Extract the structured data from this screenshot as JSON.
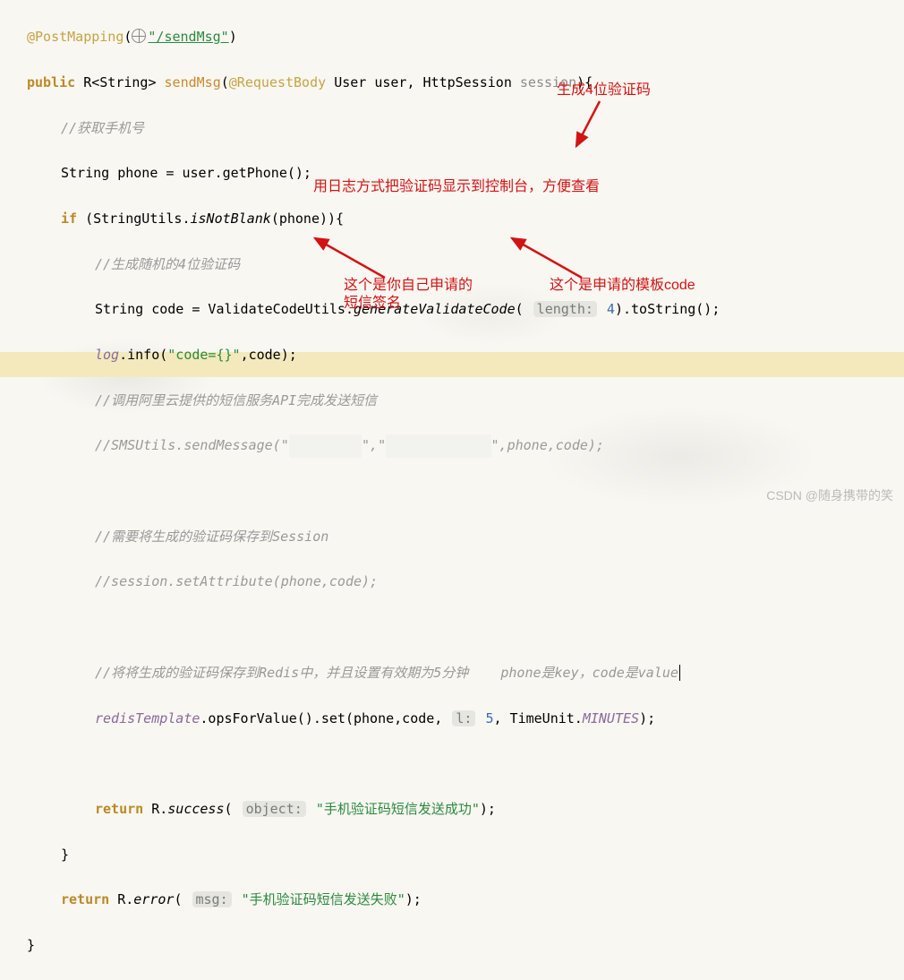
{
  "code": {
    "ann_name": "@PostMapping",
    "ann_path": "\"/sendMsg\"",
    "sig_public": "public",
    "sig_type": "R<String>",
    "sig_name": "sendMsg",
    "sig_params_ann": "@RequestBody",
    "sig_params_rest": "User user, HttpSession ",
    "sig_param_session": "session",
    "sig_tail": "){",
    "c1": "//获取手机号",
    "l_phone": "String phone = user.getPhone();",
    "if_kw": "if",
    "if_call": "(StringUtils.",
    "if_meth": "isNotBlank",
    "if_tail": "(phone)){",
    "c2": "//生成随机的4位验证码",
    "l_code_pre": "String code = ValidateCodeUtils.",
    "l_code_m": "generateValidateCode",
    "l_code_hint": "length:",
    "l_code_arg": "4",
    "l_code_tail": ").toString();",
    "log_field": "log",
    "log_call": ".info(",
    "log_fmt": "\"code={}\"",
    "log_tail": ",code);",
    "c3": "//调用阿里云提供的短信服务API完成发送短信",
    "c4_pre": "//SMSUtils.sendMessage(\"",
    "c4_mid": "\",\"",
    "c4_suf": "\",phone,code);",
    "c5": "//需要将生成的验证码保存到Session",
    "c6": "//session.setAttribute(phone,code);",
    "c7": "//将将生成的验证码保存到Redis中，并且设置有效期为5分钟    phone是key，code是value",
    "redis_field": "redisTemplate",
    "redis_call": ".opsForValue().set(phone,code, ",
    "redis_hint": "l:",
    "redis_arg": "5",
    "redis_tail": ", TimeUnit.",
    "redis_enum": "MINUTES",
    "redis_end": ");",
    "ret1_kw": "return",
    "ret1_call": "R.",
    "ret1_m": "success",
    "ret1_hint": "object:",
    "ret1_str": "\"手机验证码短信发送成功\"",
    "ret1_end": ");",
    "brace_close": "}",
    "ret2_kw": "return",
    "ret2_call": "R.",
    "ret2_m": "error",
    "ret2_hint": "msg:",
    "ret2_str": "\"手机验证码短信发送失败\"",
    "ret2_end": ");",
    "brace_final": "}"
  },
  "notes": {
    "n1": "生成4位验证码",
    "n2": "用日志方式把验证码显示到控制台，方便查看",
    "n3a": "这个是你自己申请的",
    "n3b": "短信签名",
    "n4": "这个是申请的模板code"
  },
  "watermark": "CSDN @随身携带的笑"
}
